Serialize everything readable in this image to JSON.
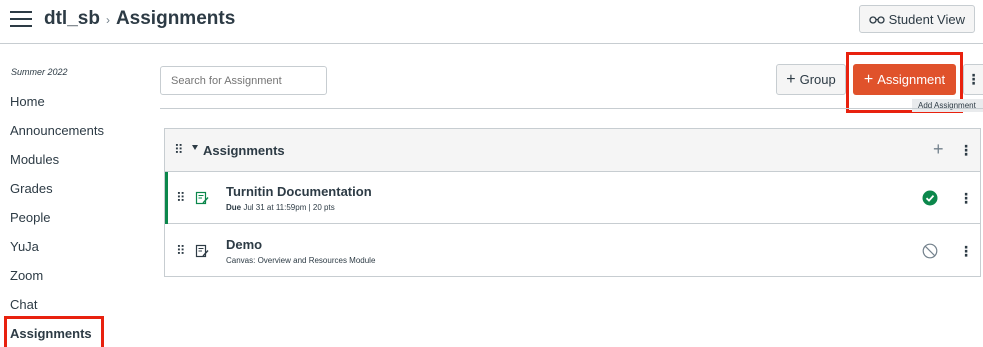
{
  "header": {
    "course": "dtl_sb",
    "separator": "›",
    "page": "Assignments",
    "student_view_label": "Student View"
  },
  "sidebar": {
    "term": "Summer 2022",
    "items": [
      {
        "label": "Home"
      },
      {
        "label": "Announcements"
      },
      {
        "label": "Modules"
      },
      {
        "label": "Grades"
      },
      {
        "label": "People"
      },
      {
        "label": "YuJa"
      },
      {
        "label": "Zoom"
      },
      {
        "label": "Chat"
      },
      {
        "label": "Assignments"
      }
    ]
  },
  "toolbar": {
    "search_placeholder": "Search for Assignment",
    "group_label": "Group",
    "assignment_label": "Assignment",
    "plus_glyph": "+",
    "tooltip": "Add Assignment"
  },
  "group": {
    "title": "Assignments",
    "plus_glyph": "+",
    "assignments": [
      {
        "title": "Turnitin Documentation",
        "due_label": "Due",
        "due_value": "Jul 31 at 11:59pm",
        "points": "|  20 pts",
        "status": "published"
      },
      {
        "title": "Demo",
        "subtitle": "Canvas: Overview and Resources Module",
        "status": "unpublished"
      }
    ]
  },
  "colors": {
    "accent": "#e0522b",
    "highlight": "#e8210e",
    "published": "#0b874b",
    "text": "#2d3b45"
  }
}
